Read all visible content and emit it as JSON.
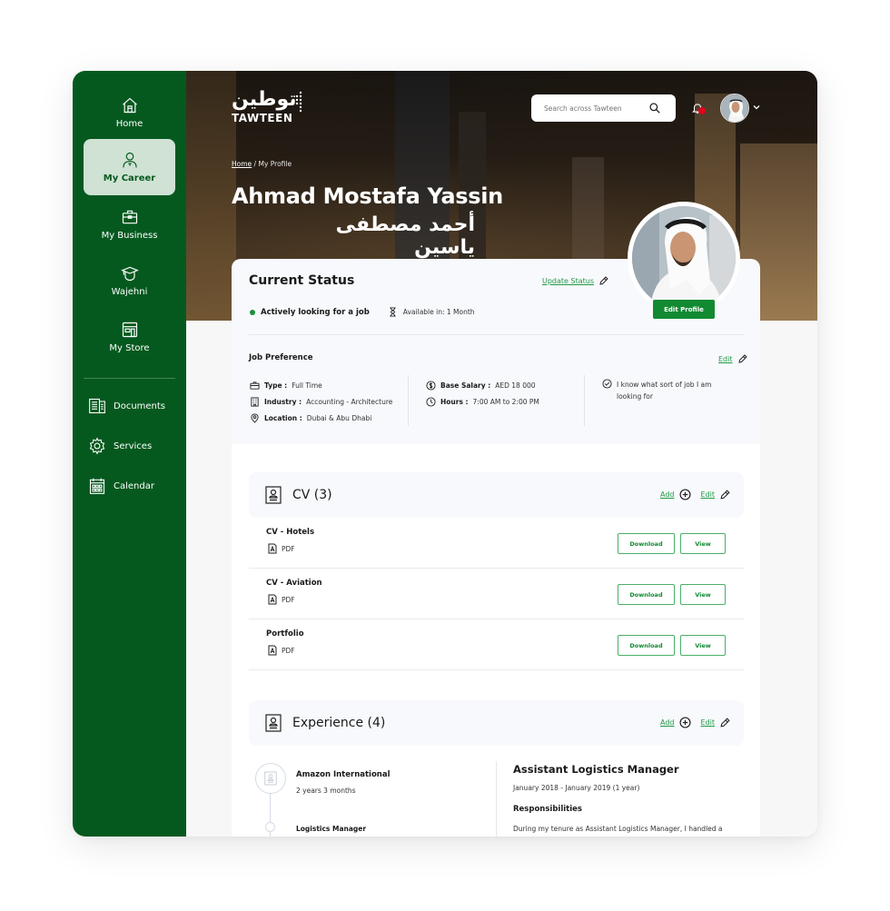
{
  "sidebar": {
    "items": [
      {
        "label": "Home",
        "icon": "home-icon",
        "active": false
      },
      {
        "label": "My Career",
        "icon": "career-person-icon",
        "active": true
      },
      {
        "label": "My Business",
        "icon": "briefcase-icon",
        "active": false
      },
      {
        "label": "Wajehni",
        "icon": "graduation-cap-icon",
        "active": false
      },
      {
        "label": "My Store",
        "icon": "store-icon",
        "active": false
      }
    ],
    "secondary": [
      {
        "label": "Documents",
        "icon": "documents-icon"
      },
      {
        "label": "Services",
        "icon": "gear-icon"
      },
      {
        "label": "Calendar",
        "icon": "calendar-icon"
      }
    ]
  },
  "header": {
    "logo_ar": "توطين",
    "logo_en": "TAWTEEN",
    "search_placeholder": "Search across Tawteen",
    "notification_badge": true
  },
  "breadcrumb": {
    "home": "Home",
    "separator": "/",
    "current": "My Profile"
  },
  "profile": {
    "name_en": "Ahmad Mostafa Yassin",
    "name_ar": "أحمد مصطفى ياسين",
    "edit_profile_label": "Edit Profile"
  },
  "status": {
    "title": "Current Status",
    "update_label": "Update Status",
    "status_text": "Actively looking for a job",
    "status_color": "#1a8f3c",
    "available": "Available in: 1 Month"
  },
  "job_preference": {
    "title": "Job Preference",
    "edit_label": "Edit",
    "type_label": "Type :",
    "type_value": "Full Time",
    "industry_label": "Industry :",
    "industry_value": "Accounting - Architecture",
    "location_label": "Location :",
    "location_value": "Dubai & Abu Dhabi",
    "salary_label": "Base Salary :",
    "salary_value": "AED 18 000",
    "hours_label": "Hours :",
    "hours_value": "7:00 AM to 2:00 PM",
    "knows_job": "I know what sort of job I am looking for"
  },
  "cv": {
    "title": "CV (3)",
    "add_label": "Add",
    "edit_label": "Edit",
    "items": [
      {
        "name": "CV - Hotels",
        "type": "PDF",
        "download": "Download",
        "view": "View"
      },
      {
        "name": "CV - Aviation",
        "type": "PDF",
        "download": "Download",
        "view": "View"
      },
      {
        "name": "Portfolio",
        "type": "PDF",
        "download": "Download",
        "view": "View"
      }
    ]
  },
  "experience": {
    "title": "Experience (4)",
    "add_label": "Add",
    "edit_label": "Edit",
    "company": "Amazon International",
    "duration": "2 years 3 months",
    "role": "Logistics Manager",
    "detail_title": "Assistant Logistics Manager",
    "detail_dates": "January 2018 - January 2019 (1 year)",
    "responsibilities_label": "Responsibilities",
    "description": "During my tenure as Assistant Logistics Manager, I handled a"
  },
  "colors": {
    "brand_green": "#05591f",
    "accent_green": "#128a32",
    "link_green": "#1f9a45",
    "notification_red": "#e3001b"
  }
}
